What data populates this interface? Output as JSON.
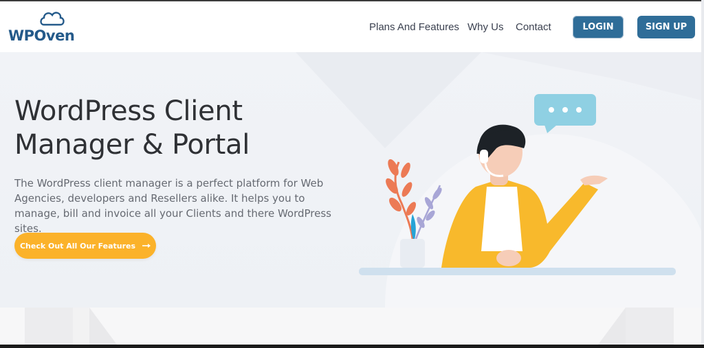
{
  "brand": {
    "name": "WPOven",
    "color": "#245a8a"
  },
  "nav": {
    "items": [
      {
        "label": "Plans And Features"
      },
      {
        "label": "Why Us"
      },
      {
        "label": "Contact"
      }
    ],
    "login_label": "LOGIN",
    "signup_label": "SIGN UP",
    "button_color": "#2f6d98"
  },
  "hero": {
    "title_line1": "WordPress Client",
    "title_line2": "Manager & Portal",
    "description": "The WordPress client manager is a perfect platform for Web Agencies, developers and Resellers alike. It helps you to manage, bill and invoice all your Clients and there WordPress sites.",
    "cta_label": "Check Out All Our Features",
    "cta_icon": "arrow-right-icon",
    "cta_color": "#fbb22a"
  },
  "illustration": {
    "subject": "support-agent-with-headset",
    "chat_bubble_icon": "chat-bubble-icon",
    "plant_icon": "potted-plant-icon"
  }
}
